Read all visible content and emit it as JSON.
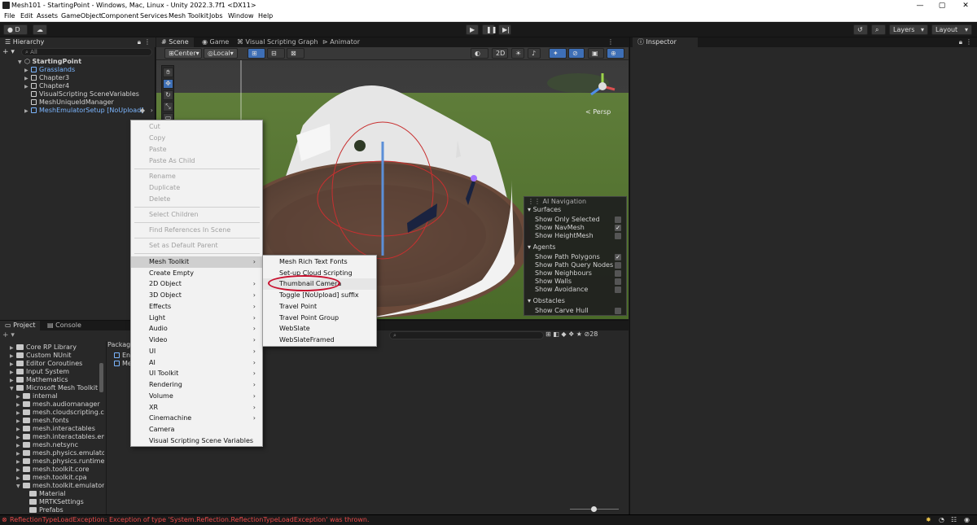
{
  "window": {
    "title": "Mesh101 - StartingPoint - Windows, Mac, Linux - Unity 2022.3.7f1 <DX11>",
    "controls": [
      "—",
      "▢",
      "✕"
    ]
  },
  "menubar": [
    "File",
    "Edit",
    "Assets",
    "GameObject",
    "Component",
    "Services",
    "Mesh Toolkit",
    "Jobs",
    "Window",
    "Help"
  ],
  "toolbar": {
    "account": "D",
    "layers": "Layers",
    "layout": "Layout"
  },
  "hierarchy": {
    "tab": "Hierarchy",
    "search_placeholder": "All",
    "items": [
      {
        "label": "StartingPoint"
      },
      {
        "label": "Grasslands"
      },
      {
        "label": "Chapter3"
      },
      {
        "label": "Chapter4"
      },
      {
        "label": "VisualScripting SceneVariables"
      },
      {
        "label": "MeshUniqueIdManager"
      },
      {
        "label": "MeshEmulatorSetup [NoUpload]"
      }
    ]
  },
  "scene": {
    "tabs": [
      "Scene",
      "Game",
      "Visual Scripting Graph",
      "Animator"
    ],
    "pivot": "Center",
    "space": "Local",
    "mode_2d": "2D",
    "persp": "< Persp"
  },
  "ai_overlay": {
    "title": "AI Navigation",
    "surfaces_label": "Surfaces",
    "surfaces": [
      {
        "label": "Show Only Selected",
        "checked": false
      },
      {
        "label": "Show NavMesh",
        "checked": true
      },
      {
        "label": "Show HeightMesh",
        "checked": false
      }
    ],
    "agents_label": "Agents",
    "agents": [
      {
        "label": "Show Path Polygons",
        "checked": true
      },
      {
        "label": "Show Path Query Nodes",
        "checked": false
      },
      {
        "label": "Show Neighbours",
        "checked": false
      },
      {
        "label": "Show Walls",
        "checked": false
      },
      {
        "label": "Show Avoidance",
        "checked": false
      }
    ],
    "obstacles_label": "Obstacles",
    "obstacles": [
      {
        "label": "Show Carve Hull",
        "checked": false
      }
    ]
  },
  "inspector": {
    "tab": "Inspector"
  },
  "project": {
    "tabs": [
      "Project",
      "Console"
    ],
    "count": "28",
    "packages_label": "Packag",
    "folders": [
      "Core RP Library",
      "Custom NUnit",
      "Editor Coroutines",
      "Input System",
      "Mathematics",
      "Microsoft Mesh Toolkit",
      "internal",
      "mesh.audiomanager",
      "mesh.cloudscripting.clie",
      "mesh.fonts",
      "mesh.interactables",
      "mesh.interactables.emu",
      "mesh.netsync",
      "mesh.physics.emulator",
      "mesh.physics.runtime",
      "mesh.toolkit.core",
      "mesh.toolkit.cpa",
      "mesh.toolkit.emulator",
      "Material",
      "MRTKSettings",
      "Prefabs"
    ],
    "assets": [
      "En",
      "Me"
    ]
  },
  "status": {
    "error": "ReflectionTypeLoadException: Exception of type 'System.Reflection.ReflectionTypeLoadException' was thrown."
  },
  "context_menu": {
    "items": [
      {
        "label": "Cut",
        "disabled": true
      },
      {
        "label": "Copy",
        "disabled": true
      },
      {
        "label": "Paste",
        "disabled": true
      },
      {
        "label": "Paste As Child",
        "disabled": true
      },
      {
        "label": "Rename",
        "disabled": true
      },
      {
        "label": "Duplicate",
        "disabled": true
      },
      {
        "label": "Delete",
        "disabled": true
      },
      {
        "label": "Select Children",
        "disabled": true
      },
      {
        "label": "Find References In Scene",
        "disabled": true
      },
      {
        "label": "Set as Default Parent",
        "disabled": true
      },
      {
        "label": "Mesh Toolkit",
        "submenu": true
      },
      {
        "label": "Create Empty"
      },
      {
        "label": "2D Object",
        "submenu": true
      },
      {
        "label": "3D Object",
        "submenu": true
      },
      {
        "label": "Effects",
        "submenu": true
      },
      {
        "label": "Light",
        "submenu": true
      },
      {
        "label": "Audio",
        "submenu": true
      },
      {
        "label": "Video",
        "submenu": true
      },
      {
        "label": "UI",
        "submenu": true
      },
      {
        "label": "AI",
        "submenu": true
      },
      {
        "label": "UI Toolkit",
        "submenu": true
      },
      {
        "label": "Rendering",
        "submenu": true
      },
      {
        "label": "Volume",
        "submenu": true
      },
      {
        "label": "XR",
        "submenu": true
      },
      {
        "label": "Cinemachine",
        "submenu": true
      },
      {
        "label": "Camera"
      },
      {
        "label": "Visual Scripting Scene Variables"
      }
    ]
  },
  "submenu": {
    "items": [
      "Mesh Rich Text Fonts",
      "Set-up Cloud Scripting",
      "Thumbnail Camera",
      "Toggle [NoUpload] suffix",
      "Travel Point",
      "Travel Point Group",
      "WebSlate",
      "WebSlateFramed"
    ],
    "highlight_color": "#c8102e"
  }
}
